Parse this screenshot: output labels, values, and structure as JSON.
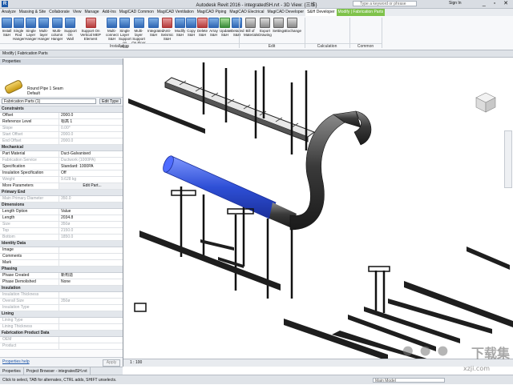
{
  "titlebar": {
    "app_letter": "R",
    "title": "Autodesk Revit 2016 -   integratedSH.rvt - 3D View: {三维}",
    "search_placeholder": "Type a keyword or phrase",
    "signin": "Sign In",
    "window_buttons": "_ ▫ ✕"
  },
  "tabs": [
    "Analyze",
    "Massing & Site",
    "Collaborate",
    "View",
    "Manage",
    "Add-Ins",
    "MagiCAD Common",
    "MagiCAD Ventilation",
    "MagiCAD Piping",
    "MagiCAD Electrical",
    "MagiCAD Developer",
    "S&H Developer",
    "Modify | Fabrication Parts"
  ],
  "ribbon": {
    "buttons": [
      {
        "label": "Install S&H",
        "style": "blue"
      },
      {
        "label": "Single Rod Hanger",
        "style": "blue"
      },
      {
        "label": "Single Layer Hanger",
        "style": "blue"
      },
      {
        "label": "Multi-layer Hanger",
        "style": "blue"
      },
      {
        "label": "Multi-column Hanger",
        "style": "blue"
      },
      {
        "label": "Support On Wall",
        "style": "blue"
      },
      {
        "label": "Support On Vertical MEP Element",
        "style": "red"
      },
      {
        "label": "Multi-connect S&H",
        "style": "blue"
      },
      {
        "label": "Single Layer Support on Floor",
        "style": "blue"
      },
      {
        "label": "Multi-layer Support On Floor",
        "style": "blue"
      },
      {
        "label": "Integrated S&H",
        "style": "blue"
      },
      {
        "label": "Anti-Seismic S&H",
        "style": "red"
      },
      {
        "label": "Modify S&H",
        "style": "blue"
      },
      {
        "label": "Copy S&H",
        "style": "blue"
      },
      {
        "label": "Delete S&H",
        "style": "red"
      },
      {
        "label": "Array S&H",
        "style": "blue"
      },
      {
        "label": "Update S&H",
        "style": "green"
      },
      {
        "label": "Detailed S&H",
        "style": "blue"
      },
      {
        "label": "Bill of Materials",
        "style": "grey"
      },
      {
        "label": "Export Drawing",
        "style": "grey"
      },
      {
        "label": "Settings",
        "style": "grey"
      },
      {
        "label": "Exchange",
        "style": "grey"
      }
    ],
    "groups": [
      "Installation",
      "Edit",
      "Calculation",
      "Common"
    ]
  },
  "mode_bar": "Modify | Fabrication Parts",
  "properties": {
    "header": "Properties",
    "type_name": "Round Pipe 1 Seam",
    "type_sub": "Default",
    "filter": "Fabrication Parts (1)",
    "edit_type": "Edit Type",
    "sections": [
      {
        "title": "Constraints",
        "rows": [
          {
            "k": "Offset",
            "v": "2000.0",
            "dim": false
          },
          {
            "k": "Reference Level",
            "v": "标高 1",
            "dim": false
          },
          {
            "k": "Slope",
            "v": "0.00°",
            "dim": true
          },
          {
            "k": "Start Offset",
            "v": "2000.0",
            "dim": true
          },
          {
            "k": "End Offset",
            "v": "2000.0",
            "dim": true
          }
        ]
      },
      {
        "title": "Mechanical",
        "rows": [
          {
            "k": "Part Material",
            "v": "Duct-Galvanised",
            "dim": false
          },
          {
            "k": "Fabrication Service",
            "v": "Ductwork (1000PA)",
            "dim": true
          },
          {
            "k": "Specification",
            "v": "Standard: 1000PA",
            "dim": false
          },
          {
            "k": "Insulation Specification",
            "v": "Off",
            "dim": false
          },
          {
            "k": "Weight",
            "v": "9.628 kg",
            "dim": true
          },
          {
            "k": "More Parameters",
            "v": "Edit Part...",
            "dim": false,
            "btn": true
          }
        ]
      },
      {
        "title": "Primary End",
        "rows": [
          {
            "k": "Main Primary Diameter",
            "v": "350.0",
            "dim": true
          }
        ]
      },
      {
        "title": "Dimensions",
        "rows": [
          {
            "k": "Length Option",
            "v": "Value",
            "dim": false
          },
          {
            "k": "Length",
            "v": "2034.8",
            "dim": false
          },
          {
            "k": "Size",
            "v": "350ø",
            "dim": true
          },
          {
            "k": "Top",
            "v": "2150.0",
            "dim": true
          },
          {
            "k": "Bottom",
            "v": "1850.0",
            "dim": true
          }
        ]
      },
      {
        "title": "Identity Data",
        "rows": [
          {
            "k": "Image",
            "v": "",
            "dim": false
          },
          {
            "k": "Comments",
            "v": "",
            "dim": false
          },
          {
            "k": "Mark",
            "v": "",
            "dim": false
          }
        ]
      },
      {
        "title": "Phasing",
        "rows": [
          {
            "k": "Phase Created",
            "v": "新构造",
            "dim": false
          },
          {
            "k": "Phase Demolished",
            "v": "None",
            "dim": false
          }
        ]
      },
      {
        "title": "Insulation",
        "rows": [
          {
            "k": "Insulation Thickness",
            "v": "",
            "dim": true
          },
          {
            "k": "Overall Size",
            "v": "350ø",
            "dim": true
          },
          {
            "k": "Insulation Type",
            "v": "",
            "dim": true
          }
        ]
      },
      {
        "title": "Lining",
        "rows": [
          {
            "k": "Lining Type",
            "v": "",
            "dim": true
          },
          {
            "k": "Lining Thickness",
            "v": "",
            "dim": true
          }
        ]
      },
      {
        "title": "Fabrication Product Data",
        "rows": [
          {
            "k": "OEM",
            "v": "",
            "dim": true
          },
          {
            "k": "Product",
            "v": "",
            "dim": true
          }
        ]
      }
    ],
    "help_link": "Properties help",
    "apply": "Apply"
  },
  "view": {
    "scale": "1 : 100",
    "viewcube_label": "FRONT"
  },
  "bottom_tabs": [
    "Properties",
    "Project Browser - integratedSH.rvt"
  ],
  "statusbar": {
    "text": "Click to select, TAB for alternates, CTRL adds, SHIFT unselects.",
    "model": "Main Model"
  },
  "watermark": {
    "glyph": "•••",
    "brand": "下载集",
    "url": "xzji.com"
  }
}
